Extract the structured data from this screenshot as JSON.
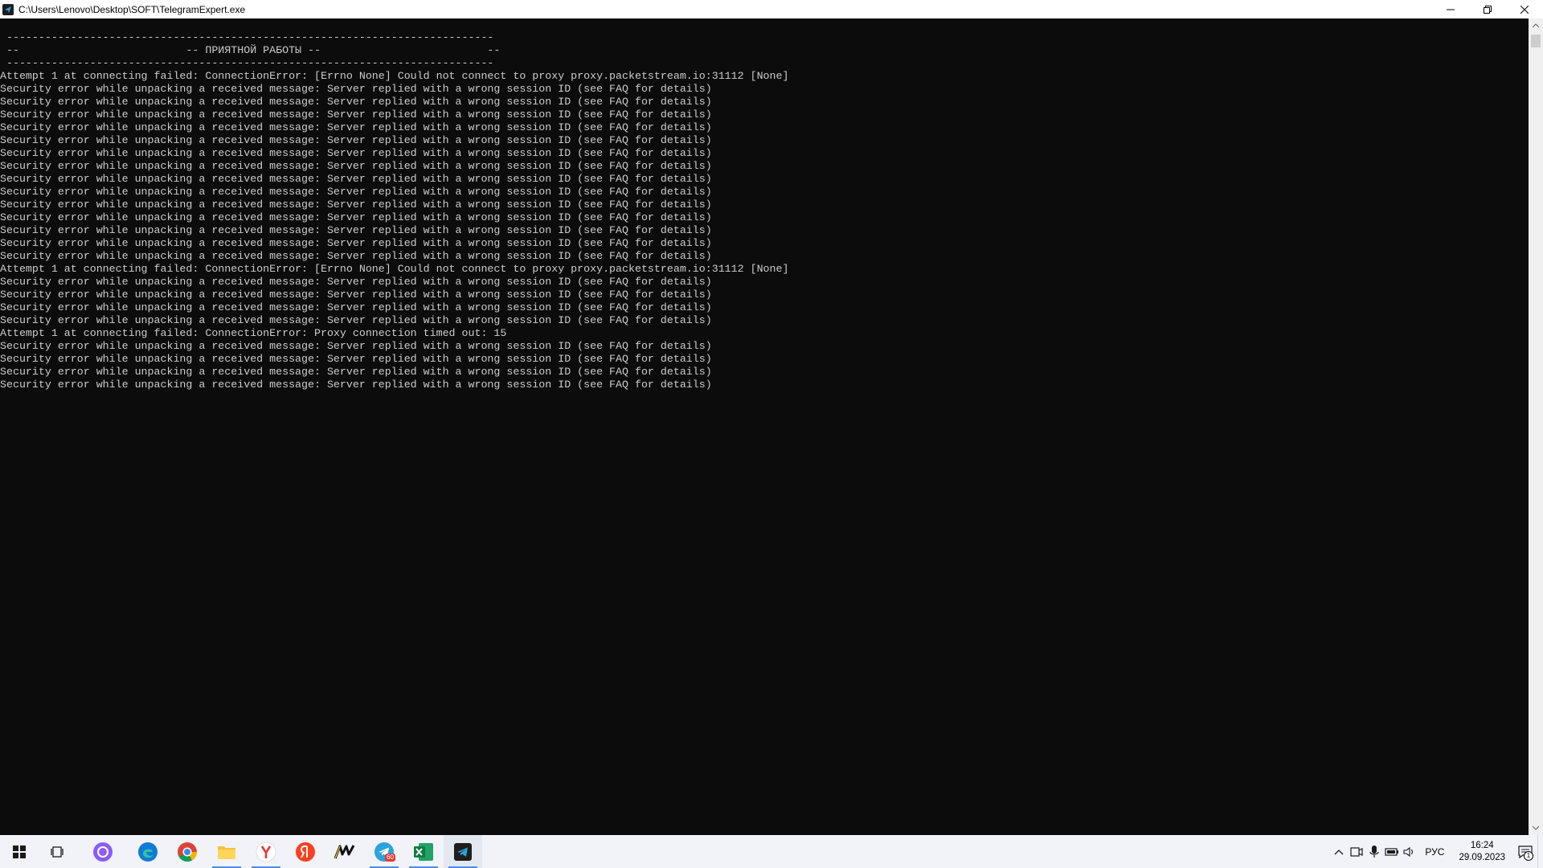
{
  "window": {
    "title": "C:\\Users\\Lenovo\\Desktop\\SOFT\\TelegramExpert.exe"
  },
  "console": {
    "lines": [
      " ----------------------------------------------------------------------------",
      " --                          -- ПРИЯТНОЙ РАБОТЫ --                          --",
      " ----------------------------------------------------------------------------",
      "Attempt 1 at connecting failed: ConnectionError: [Errno None] Could not connect to proxy proxy.packetstream.io:31112 [None]",
      "Security error while unpacking a received message: Server replied with a wrong session ID (see FAQ for details)",
      "Security error while unpacking a received message: Server replied with a wrong session ID (see FAQ for details)",
      "Security error while unpacking a received message: Server replied with a wrong session ID (see FAQ for details)",
      "Security error while unpacking a received message: Server replied with a wrong session ID (see FAQ for details)",
      "Security error while unpacking a received message: Server replied with a wrong session ID (see FAQ for details)",
      "Security error while unpacking a received message: Server replied with a wrong session ID (see FAQ for details)",
      "Security error while unpacking a received message: Server replied with a wrong session ID (see FAQ for details)",
      "Security error while unpacking a received message: Server replied with a wrong session ID (see FAQ for details)",
      "Security error while unpacking a received message: Server replied with a wrong session ID (see FAQ for details)",
      "Security error while unpacking a received message: Server replied with a wrong session ID (see FAQ for details)",
      "Security error while unpacking a received message: Server replied with a wrong session ID (see FAQ for details)",
      "Security error while unpacking a received message: Server replied with a wrong session ID (see FAQ for details)",
      "Security error while unpacking a received message: Server replied with a wrong session ID (see FAQ for details)",
      "Security error while unpacking a received message: Server replied with a wrong session ID (see FAQ for details)",
      "Attempt 1 at connecting failed: ConnectionError: [Errno None] Could not connect to proxy proxy.packetstream.io:31112 [None]",
      "Security error while unpacking a received message: Server replied with a wrong session ID (see FAQ for details)",
      "Security error while unpacking a received message: Server replied with a wrong session ID (see FAQ for details)",
      "Security error while unpacking a received message: Server replied with a wrong session ID (see FAQ for details)",
      "Security error while unpacking a received message: Server replied with a wrong session ID (see FAQ for details)",
      "Attempt 1 at connecting failed: ConnectionError: Proxy connection timed out: 15",
      "Security error while unpacking a received message: Server replied with a wrong session ID (see FAQ for details)",
      "Security error while unpacking a received message: Server replied with a wrong session ID (see FAQ for details)",
      "Security error while unpacking a received message: Server replied with a wrong session ID (see FAQ for details)",
      "Security error while unpacking a received message: Server replied with a wrong session ID (see FAQ for details)"
    ]
  },
  "taskbar": {
    "apps": [
      {
        "name": "start-button",
        "icon": "windows-icon"
      },
      {
        "name": "task-view-button",
        "icon": "task-view-icon"
      },
      {
        "name": "alice-button",
        "icon": "alice-icon"
      },
      {
        "name": "edge-button",
        "icon": "edge-icon"
      },
      {
        "name": "chrome-button",
        "icon": "chrome-icon"
      },
      {
        "name": "explorer-button",
        "icon": "folder-icon"
      },
      {
        "name": "yandex-browser-button",
        "icon": "yandex-browser-icon"
      },
      {
        "name": "yandex-button",
        "icon": "yandex-icon"
      },
      {
        "name": "miro-button",
        "icon": "miro-icon"
      },
      {
        "name": "telegram-button",
        "icon": "telegram-icon",
        "badge": "60"
      },
      {
        "name": "excel-button",
        "icon": "excel-icon"
      },
      {
        "name": "telegram-expert-button",
        "icon": "telegram-expert-icon"
      }
    ],
    "tray": {
      "language": "РУС",
      "time": "16:24",
      "date": "29.09.2023",
      "notifications_count": "1"
    }
  },
  "colors": {
    "console_bg": "#0c0c0c",
    "console_text": "#cccccc",
    "taskbar_bg": "#f1f3f8",
    "accent": "#4a90e2"
  }
}
